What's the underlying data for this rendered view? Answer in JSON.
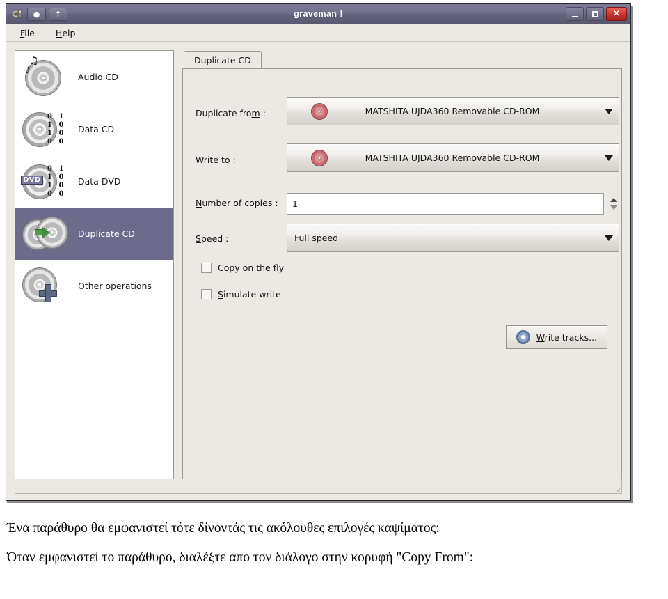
{
  "window": {
    "title": "graveman !",
    "titlebar_buttons": {
      "app_icon": "app-icon",
      "record_label": "●",
      "eject_label": "↑",
      "minimize_label": "–",
      "maximize_label": "□",
      "close_label": "✕"
    }
  },
  "menubar": {
    "items": [
      {
        "accel": "F",
        "rest": "ile"
      },
      {
        "accel": "H",
        "rest": "elp"
      }
    ]
  },
  "sidebar": {
    "items": [
      {
        "label": "Audio CD",
        "icon": "audio-cd-icon",
        "selected": false
      },
      {
        "label": "Data CD",
        "icon": "data-cd-icon",
        "selected": false
      },
      {
        "label": "Data DVD",
        "icon": "data-dvd-icon",
        "selected": false,
        "badge": "DVD"
      },
      {
        "label": "Duplicate CD",
        "icon": "duplicate-cd-icon",
        "selected": true
      },
      {
        "label": "Other operations",
        "icon": "other-operations-icon",
        "selected": false
      }
    ],
    "binary_pattern": [
      "0 1",
      "1 0",
      "1 0",
      "0 0"
    ]
  },
  "main": {
    "tabs": [
      {
        "label": "Duplicate CD",
        "active": true
      }
    ],
    "fields": {
      "duplicate_from": {
        "label_accel_pre": "Duplicate fro",
        "label_accel": "m",
        "label_post": " :",
        "value": "MATSHITA UJDA360 Removable CD-ROM",
        "icon": "cd-disc-icon"
      },
      "write_to": {
        "label_accel_pre": "Write t",
        "label_accel": "o",
        "label_post": " :",
        "value": "MATSHITA UJDA360 Removable CD-ROM",
        "icon": "cd-disc-icon"
      },
      "number_of_copies": {
        "label_accel": "N",
        "label_rest": "umber of copies :",
        "value": "1"
      },
      "speed": {
        "label_accel": "S",
        "label_rest": "peed :",
        "value": "Full speed"
      }
    },
    "checkboxes": [
      {
        "pre": "Copy on the fl",
        "accel": "y",
        "post": "",
        "checked": false
      },
      {
        "pre": "",
        "accel": "S",
        "post": "imulate write",
        "checked": false
      }
    ],
    "write_button": {
      "pre": "",
      "accel": "W",
      "post": "rite tracks...",
      "icon": "write-disc-icon"
    }
  },
  "statusbar": {
    "text": ""
  },
  "caption": {
    "paragraph1": "Ένα παράθυρο θα εμφανιστεί τότε δίνοντάς τις ακόλουθες επιλογές καψίματος:",
    "paragraph2": "Όταν εμφανιστεί το παράθυρο, διαλέξτε απο τον διάλογο στην κορυφή \"Copy From\":"
  },
  "colors": {
    "titlebar": "#6c6b8b",
    "selection": "#6c6b8b",
    "window_bg": "#ece9e4",
    "close_button": "#cf3b34"
  }
}
